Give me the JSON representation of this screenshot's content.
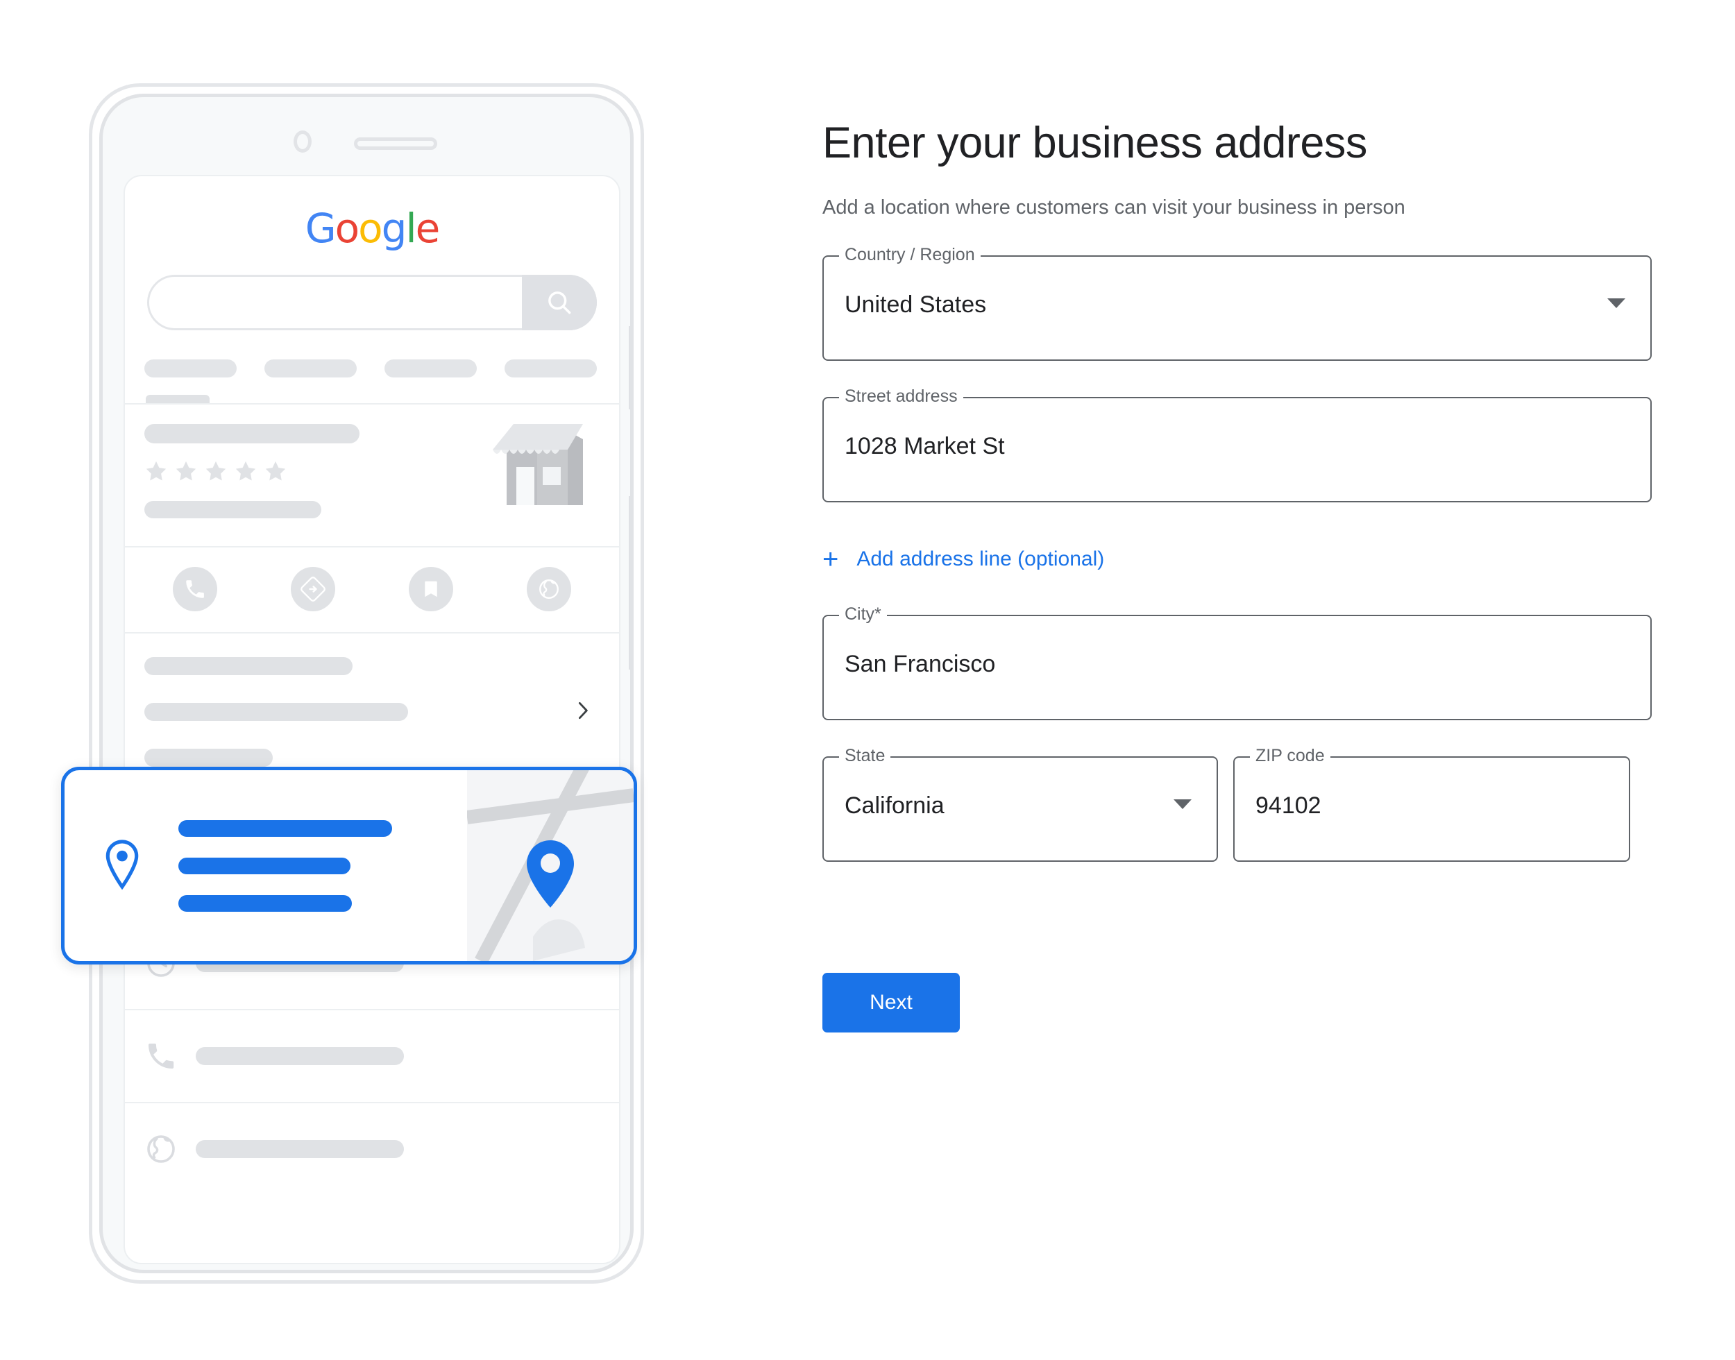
{
  "header": {
    "title": "Enter your business address",
    "subtitle": "Add a location where customers can visit your business in person"
  },
  "form": {
    "country": {
      "label": "Country / Region",
      "value": "United States",
      "control": "dropdown"
    },
    "street": {
      "label": "Street address",
      "value": "1028 Market St",
      "control": "text"
    },
    "add_address_line": {
      "label": "Add address line (optional)",
      "icon": "plus-icon",
      "color": "#1a73e8"
    },
    "city": {
      "label": "City*",
      "value": "San Francisco",
      "control": "text"
    },
    "state": {
      "label": "State",
      "value": "California",
      "control": "dropdown"
    },
    "zip": {
      "label": "ZIP code",
      "value": "94102",
      "control": "text"
    },
    "submit": {
      "label": "Next",
      "color": "#1a73e8"
    }
  },
  "illustration": {
    "device": "smartphone-mockup",
    "logo": {
      "name": "google-logo",
      "letters": [
        {
          "char": "G",
          "color": "#4285f4"
        },
        {
          "char": "o",
          "color": "#ea4335"
        },
        {
          "char": "o",
          "color": "#fbbc05"
        },
        {
          "char": "g",
          "color": "#4285f4"
        },
        {
          "char": "l",
          "color": "#34a853"
        },
        {
          "char": "e",
          "color": "#ea4335"
        }
      ]
    },
    "search": {
      "icon": "search-icon",
      "value": "",
      "placeholder": ""
    },
    "tabs_count": 4,
    "business_card": {
      "rating_stars": 5,
      "thumbnail": "storefront-icon"
    },
    "action_icons": [
      "phone-icon",
      "directions-icon",
      "bookmark-icon",
      "website-icon"
    ],
    "detail_rows": [
      "clock-icon",
      "phone-icon",
      "globe-icon"
    ],
    "highlighted_card": {
      "icon": "location-pin-icon",
      "map_icon": "map-pin-icon",
      "accent": "#1a73e8",
      "line_count": 3
    }
  }
}
